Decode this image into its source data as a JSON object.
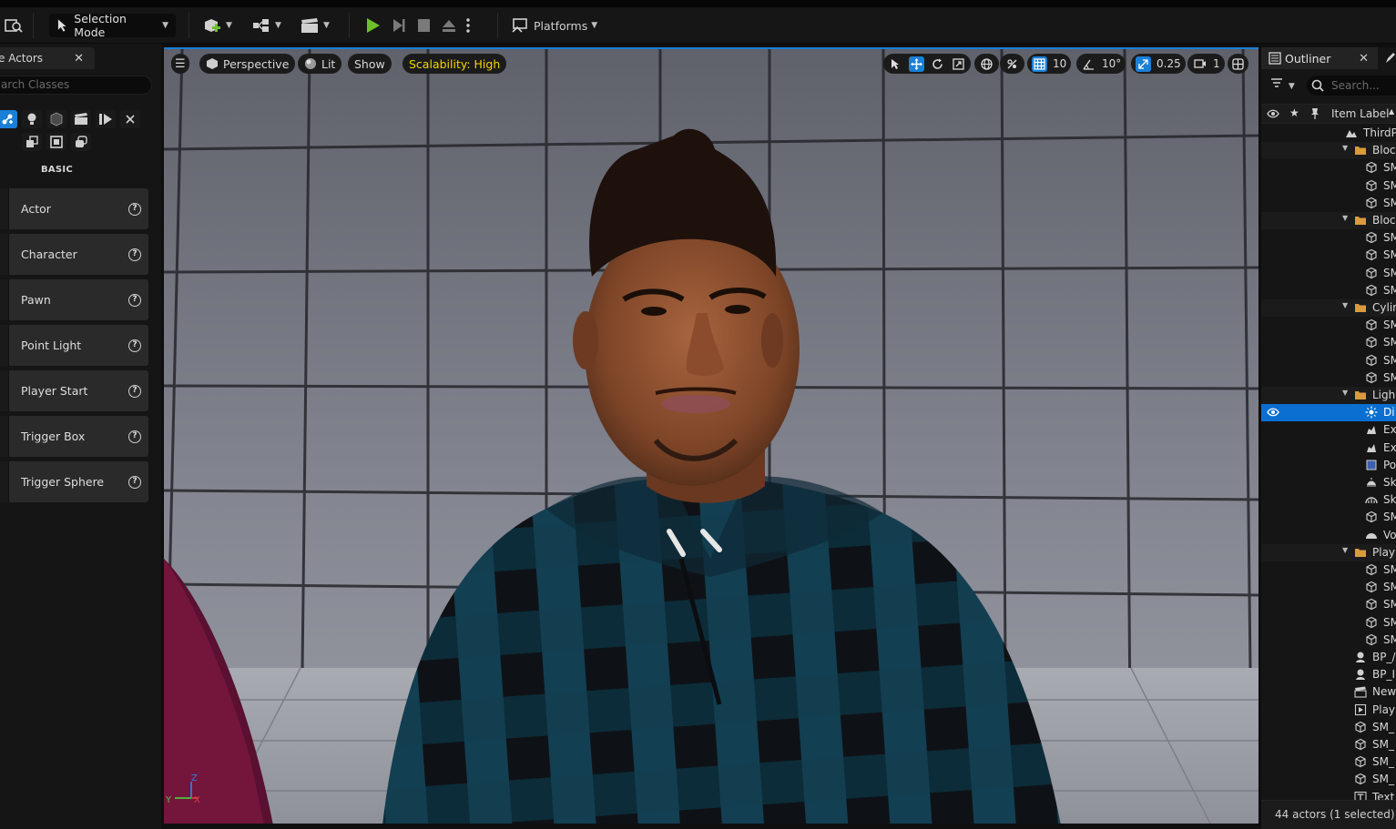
{
  "toolbar": {
    "selection_mode": "Selection Mode",
    "platforms": "Platforms"
  },
  "place_actors": {
    "tab_title": "e Actors",
    "search_placeholder": "arch Classes",
    "section": "BASIC",
    "items": [
      {
        "label": "Actor"
      },
      {
        "label": "Character"
      },
      {
        "label": "Pawn"
      },
      {
        "label": "Point Light"
      },
      {
        "label": "Player Start"
      },
      {
        "label": "Trigger Box"
      },
      {
        "label": "Trigger Sphere"
      }
    ]
  },
  "viewport": {
    "perspective": "Perspective",
    "lit": "Lit",
    "show": "Show",
    "scalability": "Scalability: High",
    "grid_snap": "10",
    "rot_snap": "10°",
    "scale_snap": "0.25",
    "camera_speed": "1",
    "axis_z": "Z",
    "axis_x": "X",
    "axis_y": "Y"
  },
  "outliner": {
    "tab_title": "Outliner",
    "search_placeholder": "Search...",
    "column": "Item Label",
    "rows": [
      {
        "label": "ThirdP",
        "indent": 0,
        "type": "level"
      },
      {
        "label": "Bloc",
        "indent": 1,
        "type": "folder"
      },
      {
        "label": "SM",
        "indent": 2,
        "type": "mesh"
      },
      {
        "label": "SM",
        "indent": 2,
        "type": "mesh"
      },
      {
        "label": "SM",
        "indent": 2,
        "type": "mesh"
      },
      {
        "label": "Bloc",
        "indent": 1,
        "type": "folder"
      },
      {
        "label": "SM",
        "indent": 2,
        "type": "mesh"
      },
      {
        "label": "SM",
        "indent": 2,
        "type": "mesh"
      },
      {
        "label": "SM",
        "indent": 2,
        "type": "mesh"
      },
      {
        "label": "SM",
        "indent": 2,
        "type": "mesh"
      },
      {
        "label": "Cylin",
        "indent": 1,
        "type": "folder"
      },
      {
        "label": "SM",
        "indent": 2,
        "type": "mesh"
      },
      {
        "label": "SM",
        "indent": 2,
        "type": "mesh"
      },
      {
        "label": "SM",
        "indent": 2,
        "type": "mesh"
      },
      {
        "label": "SM",
        "indent": 2,
        "type": "mesh"
      },
      {
        "label": "Ligh",
        "indent": 1,
        "type": "folder"
      },
      {
        "label": "Di",
        "indent": 2,
        "type": "sun",
        "selected": true
      },
      {
        "label": "Ex",
        "indent": 2,
        "type": "fog"
      },
      {
        "label": "Ex",
        "indent": 2,
        "type": "fog"
      },
      {
        "label": "Po",
        "indent": 2,
        "type": "volume"
      },
      {
        "label": "Sk",
        "indent": 2,
        "type": "sky"
      },
      {
        "label": "Sk",
        "indent": 2,
        "type": "skylight"
      },
      {
        "label": "SM",
        "indent": 2,
        "type": "mesh"
      },
      {
        "label": "Vo",
        "indent": 2,
        "type": "cloud"
      },
      {
        "label": "Play",
        "indent": 1,
        "type": "folder"
      },
      {
        "label": "SM",
        "indent": 2,
        "type": "mesh"
      },
      {
        "label": "SM",
        "indent": 2,
        "type": "mesh"
      },
      {
        "label": "SM",
        "indent": 2,
        "type": "mesh"
      },
      {
        "label": "SM",
        "indent": 2,
        "type": "mesh"
      },
      {
        "label": "SM",
        "indent": 2,
        "type": "mesh"
      },
      {
        "label": "BP_/",
        "indent": 1,
        "type": "pawn"
      },
      {
        "label": "BP_I",
        "indent": 1,
        "type": "pawn"
      },
      {
        "label": "New",
        "indent": 1,
        "type": "clapper"
      },
      {
        "label": "Play",
        "indent": 1,
        "type": "start"
      },
      {
        "label": "SM_",
        "indent": 1,
        "type": "mesh"
      },
      {
        "label": "SM_",
        "indent": 1,
        "type": "mesh"
      },
      {
        "label": "SM_",
        "indent": 1,
        "type": "mesh"
      },
      {
        "label": "SM_",
        "indent": 1,
        "type": "mesh"
      },
      {
        "label": "Text",
        "indent": 1,
        "type": "text"
      }
    ],
    "footer": "44 actors (1 selected)"
  },
  "colors": {
    "accent": "#1a7fd6",
    "play": "#6cc12b",
    "scalability": "#f2d600"
  }
}
